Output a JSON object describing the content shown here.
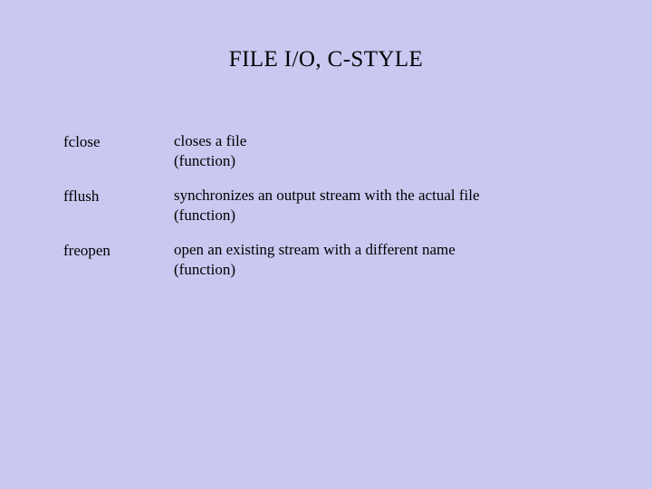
{
  "title": "FILE I/O, C-STYLE",
  "rows": [
    {
      "name": "fclose",
      "desc": "closes a file",
      "kind": "(function)"
    },
    {
      "name": "fflush",
      "desc": "synchronizes an output stream with the actual file",
      "kind": "(function)"
    },
    {
      "name": "freopen",
      "desc": "open an existing stream with a different name",
      "kind": "(function)"
    }
  ]
}
